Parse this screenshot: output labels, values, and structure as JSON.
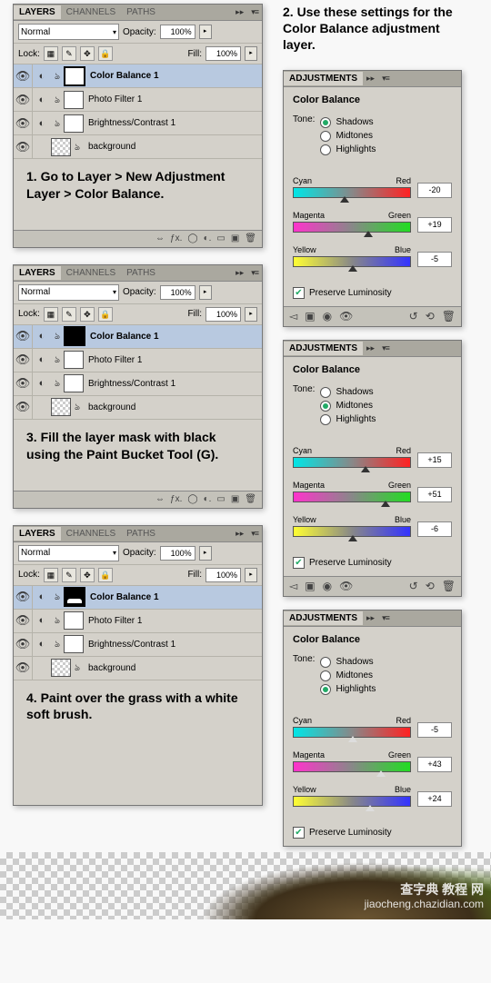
{
  "instructions": {
    "step1": "1. Go to Layer > New Adjustment Layer > Color Balance.",
    "step2": "2. Use these settings for the Color Balance adjustment layer.",
    "step3": "3. Fill the layer mask with black using the Paint Bucket Tool (G).",
    "step4": "4. Paint over the grass with a white soft brush."
  },
  "layers_panel": {
    "tabs": {
      "layers": "LAYERS",
      "channels": "CHANNELS",
      "paths": "PATHS"
    },
    "blend_mode": "Normal",
    "opacity_label": "Opacity:",
    "opacity_value": "100%",
    "lock_label": "Lock:",
    "fill_label": "Fill:",
    "fill_value": "100%",
    "layers": [
      {
        "name": "Color Balance 1"
      },
      {
        "name": "Photo Filter 1"
      },
      {
        "name": "Brightness/Contrast 1"
      },
      {
        "name": "background"
      }
    ]
  },
  "adjustments_panel": {
    "tab": "ADJUSTMENTS",
    "title": "Color Balance",
    "tone_label": "Tone:",
    "tones": {
      "shadows": "Shadows",
      "midtones": "Midtones",
      "highlights": "Highlights"
    },
    "cyan": "Cyan",
    "red": "Red",
    "magenta": "Magenta",
    "green": "Green",
    "yellow": "Yellow",
    "blue": "Blue",
    "preserve": "Preserve Luminosity"
  },
  "adj1": {
    "tone": "shadows",
    "cr": "-20",
    "mg": "+19",
    "yb": "-5",
    "crp": 40,
    "mgp": 60,
    "ybp": 47
  },
  "adj2": {
    "tone": "midtones",
    "cr": "+15",
    "mg": "+51",
    "yb": "-6",
    "crp": 58,
    "mgp": 75,
    "ybp": 47
  },
  "adj3": {
    "tone": "highlights",
    "cr": "-5",
    "mg": "+43",
    "yb": "+24",
    "crp": 47,
    "mgp": 71,
    "ybp": 62
  },
  "watermark": {
    "cn": "查字典 教程 网",
    "en": "jiaocheng.chazidian.com"
  }
}
